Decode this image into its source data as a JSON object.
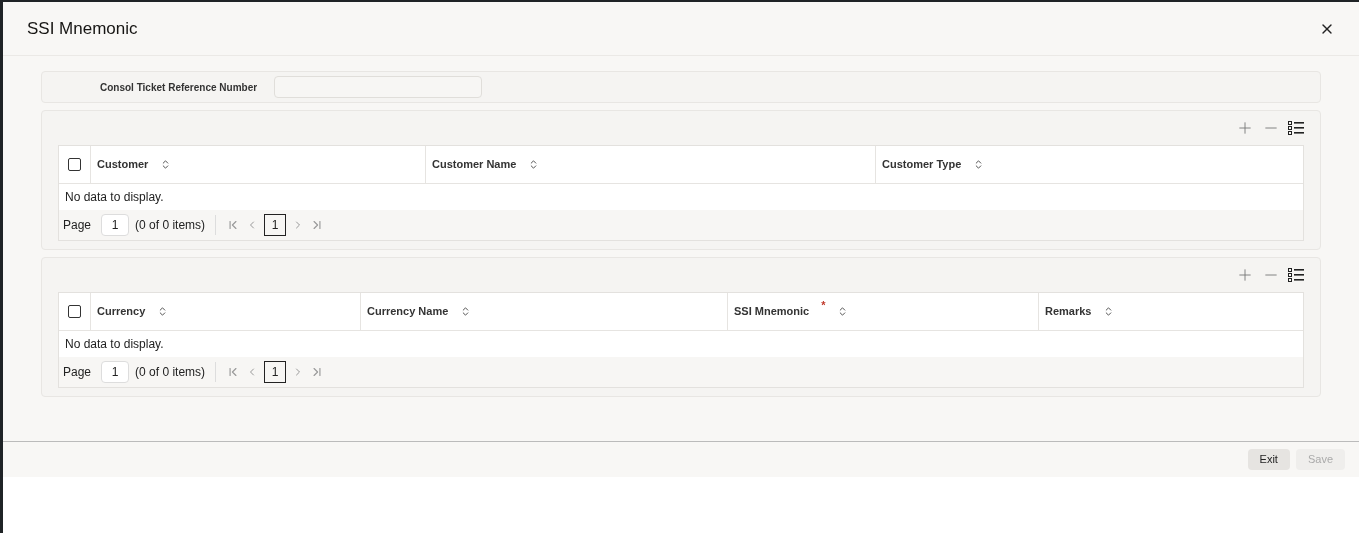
{
  "dialog": {
    "title": "SSI Mnemonic"
  },
  "field": {
    "label": "Consol Ticket Reference Number"
  },
  "grids": [
    {
      "select_all": {
        "checked": false
      },
      "columns": [
        {
          "label": "Customer",
          "required": false
        },
        {
          "label": "Customer Name",
          "required": false
        },
        {
          "label": "Customer Type",
          "required": false
        }
      ],
      "empty_text": "No data to display.",
      "pager": {
        "label": "Page",
        "page": "1",
        "summary": "(0 of 0 items)",
        "current": "1"
      }
    },
    {
      "select_all": {
        "checked": false
      },
      "columns": [
        {
          "label": "Currency",
          "required": false
        },
        {
          "label": "Currency Name",
          "required": false
        },
        {
          "label": "SSI Mnemonic",
          "required": true,
          "marker": "*"
        },
        {
          "label": "Remarks",
          "required": false
        }
      ],
      "empty_text": "No data to display.",
      "pager": {
        "label": "Page",
        "page": "1",
        "summary": "(0 of 0 items)",
        "current": "1"
      }
    }
  ],
  "buttons": [
    {
      "label": "Exit",
      "disabled": false
    },
    {
      "label": "Save",
      "disabled": true
    }
  ]
}
